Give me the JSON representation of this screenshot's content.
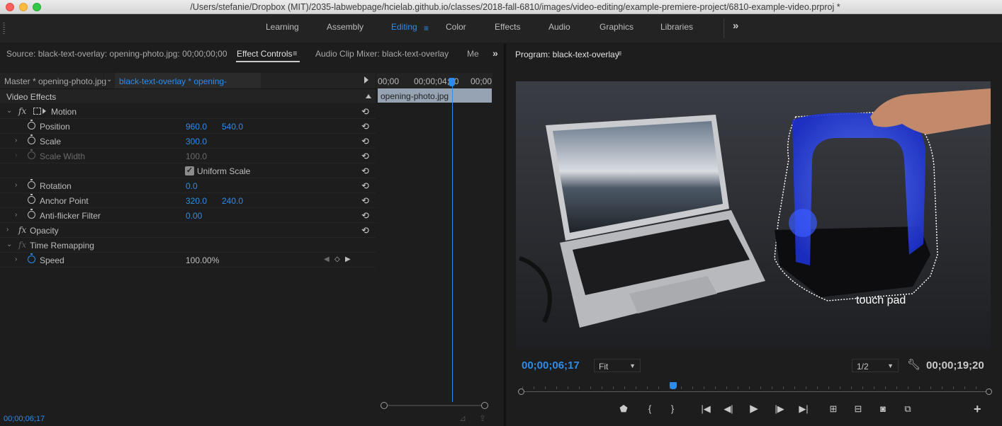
{
  "window": {
    "title": "/Users/stefanie/Dropbox (MIT)/2035-labwebpage/hcielab.github.io/classes/2018-fall-6810/images/video-editing/example-premiere-project/6810-example-video.prproj *"
  },
  "workspaces": {
    "items": [
      "Learning",
      "Assembly",
      "Editing",
      "Color",
      "Effects",
      "Audio",
      "Graphics",
      "Libraries"
    ],
    "active": "Editing",
    "menu_icon": "≡",
    "more_icon": "»"
  },
  "left_panel": {
    "tabs": {
      "source": "Source: black-text-overlay: opening-photo.jpg: 00;00;00;00",
      "effect_controls": "Effect Controls",
      "audio_clip_mixer": "Audio Clip Mixer: black-text-overlay",
      "metadata": "Me"
    },
    "tab_menu_icon": "≡",
    "more_icon": "»",
    "master_label": "Master * opening-photo.jpg",
    "sequence_clip": "black-text-overlay * opening-photo.jpg",
    "video_effects_header": "Video Effects",
    "effects": {
      "motion": "Motion",
      "position_label": "Position",
      "position_x": "960.0",
      "position_y": "540.0",
      "scale_label": "Scale",
      "scale_value": "300.0",
      "scale_width_label": "Scale Width",
      "scale_width_value": "100.0",
      "uniform_scale_label": "Uniform Scale",
      "uniform_scale_checked": true,
      "rotation_label": "Rotation",
      "rotation_value": "0.0",
      "anchor_label": "Anchor Point",
      "anchor_x": "320.0",
      "anchor_y": "240.0",
      "antiflicker_label": "Anti-flicker Filter",
      "antiflicker_value": "0.00",
      "opacity": "Opacity",
      "time_remapping": "Time Remapping",
      "speed_label": "Speed",
      "speed_value": "100.00%"
    },
    "timeline": {
      "tc_start": "00;00",
      "tc_mid": "00;00;04;00",
      "tc_end": "00;00",
      "clip_name": "opening-photo.jpg"
    },
    "current_timecode": "00;00;06;17"
  },
  "program_monitor": {
    "title": "Program: black-text-overlay",
    "menu_icon": "≡",
    "video_caption": "touch pad",
    "current_timecode": "00;00;06;17",
    "duration_timecode": "00;00;19;20",
    "zoom_select": "Fit",
    "resolution_select": "1/2",
    "playhead_fraction": 0.33,
    "transport": {
      "buttons": [
        "marker",
        "mark-in",
        "mark-out",
        "go-to-in",
        "step-back",
        "play",
        "step-forward",
        "go-to-out",
        "lift",
        "extract",
        "export-frame",
        "compare",
        "add"
      ]
    }
  },
  "colors": {
    "accent": "#2d8ceb",
    "panel_bg": "#1d1d1d",
    "clip_bg": "#96a3b3"
  }
}
